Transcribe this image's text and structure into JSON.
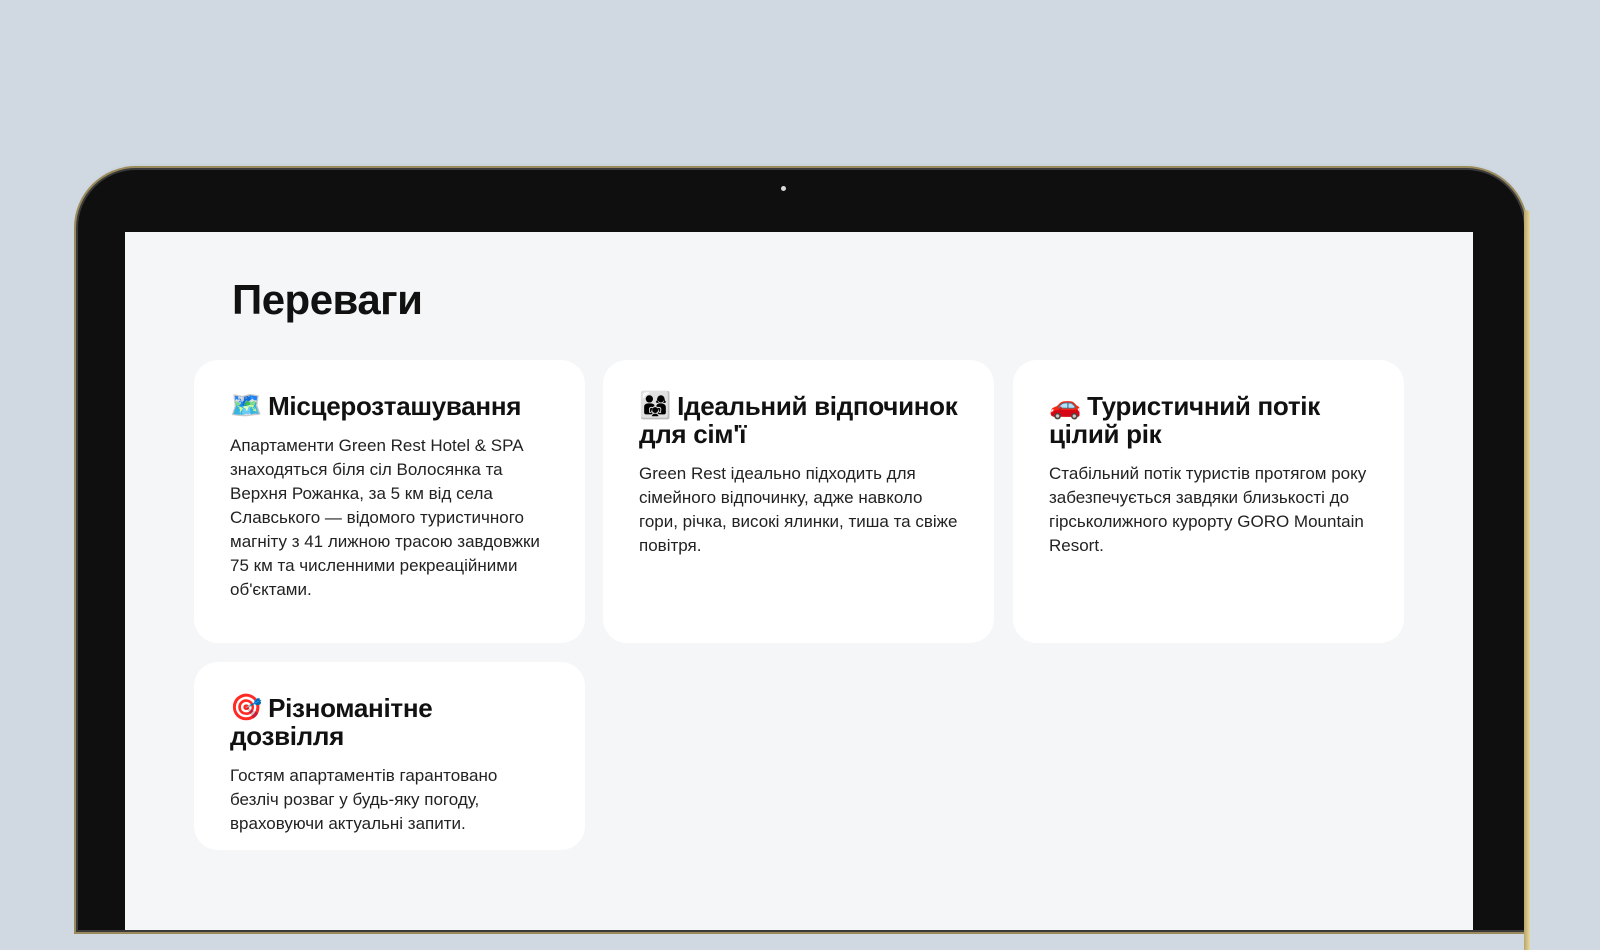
{
  "section": {
    "title": "Переваги"
  },
  "cards": [
    {
      "icon": "map-icon",
      "emoji": "🗺️",
      "title": "Місцерозташування",
      "text": "Апартаменти Green Rest Hotel & SPA знаходяться біля сіл Волосянка та Верхня Рожанка, за 5 км від села Славського — відомого туристичного магніту з 41 лижною трасою завдовжки 75 км та численними рекреаційними об'єктами."
    },
    {
      "icon": "family-icon",
      "emoji": "👨‍👩‍👧",
      "title": "Ідеальний відпочинок для сім'ї",
      "text": "Green Rest ідеально підходить для сімейного відпочинку, адже навколо гори, річка, високі ялинки, тиша та свіже повітря."
    },
    {
      "icon": "car-icon",
      "emoji": "🚗",
      "title": "Туристичний потік цілий рік",
      "text": "Стабільний потік туристів протягом року забезпечується завдяки близькості до гірськолижного курорту GORO Mountain Resort."
    },
    {
      "icon": "target-icon",
      "emoji": "🎯",
      "title": "Різноманітне дозвілля",
      "text": "Гостям апартаментів гарантовано безліч розваг у будь-яку погоду, враховуючи актуальні запити."
    }
  ],
  "colors": {
    "background": "#d0d9e2",
    "screen": "#f5f6f8",
    "card": "#ffffff",
    "text": "#111111"
  }
}
